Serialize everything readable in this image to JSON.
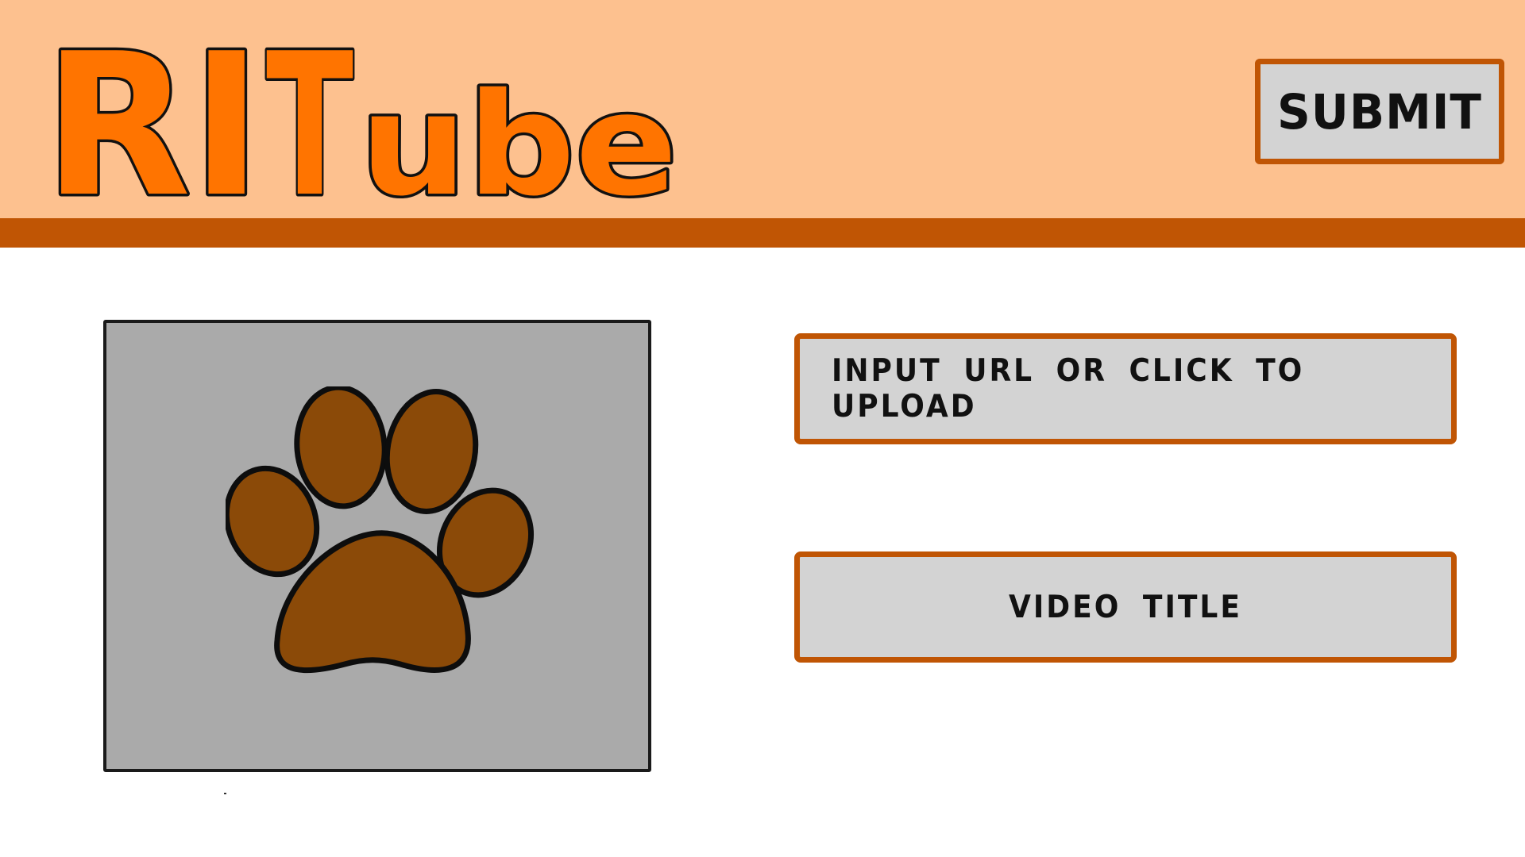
{
  "header": {
    "logo_text": "RITube",
    "logo_fill": "#ff7400",
    "background": "#fdc18f",
    "bar_color": "#c05504"
  },
  "toolbar": {
    "submit_label": "SUBMIT"
  },
  "thumbnail": {
    "icon": "paw-print-icon",
    "paw_color": "#8b4a08",
    "background": "#aaaaaa"
  },
  "form": {
    "url_placeholder": "INPUT URL OR CLICK TO UPLOAD",
    "title_placeholder": "VIDEO TITLE",
    "border_color": "#c05504",
    "field_background": "#d3d3d3"
  }
}
